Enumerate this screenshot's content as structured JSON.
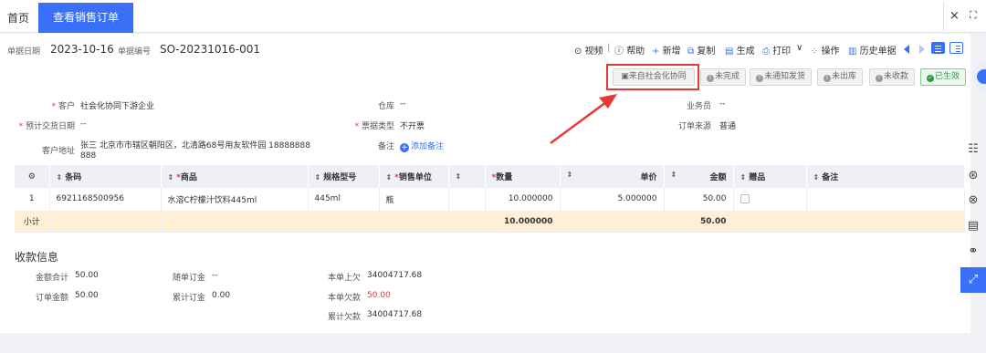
{
  "tabs": {
    "home": "首页",
    "active": "查看销售订单",
    "active_close": "×",
    "close_all": "×",
    "expand": "⛶"
  },
  "header": {
    "date_label": "单据日期",
    "date_value": "2023-10-16",
    "no_label": "单据编号",
    "no_value": "SO-20231016-001"
  },
  "toolbar": {
    "video": "视频",
    "sep": "|",
    "help": "帮助",
    "add": "新增",
    "copy": "复制",
    "generate": "生成",
    "print": "打印",
    "print_caret": "∨",
    "operate": "操作",
    "history": "历史单据"
  },
  "status": {
    "source": "来自社会化协同",
    "incomplete": "未完成",
    "not_notified": "未通知发货",
    "not_out": "未出库",
    "not_received": "未收款",
    "effective": "已生效",
    "effective_color": "#2e9b49",
    "highlight_color": "#e53935"
  },
  "form": {
    "customer_label": "客户",
    "customer_value": "社会化协同下游企业",
    "warehouse_label": "仓库",
    "warehouse_value": "--",
    "salesman_label": "业务员",
    "salesman_value": "--",
    "delivery_label": "预计交货日期",
    "delivery_value": "--",
    "invoice_label": "票据类型",
    "invoice_value": "不开票",
    "source_label": "订单来源",
    "source_value": "普通",
    "address_label": "客户地址",
    "address_line1": "张三 北京市市辖区朝阳区，北清路68号用友软件园 18888888",
    "address_line2": "888",
    "remark_label": "备注",
    "remark_add": "添加备注"
  },
  "table": {
    "columns": {
      "settings": "⚙",
      "code": "条码",
      "product": "商品",
      "spec": "规格型号",
      "unit": "销售单位",
      "blank": "",
      "qty": "数量",
      "price": "单价",
      "amount": "金额",
      "gift": "赠品",
      "note": "备注"
    },
    "rows": [
      {
        "no": "1",
        "code": "6921168500956",
        "product": "水溶C柠檬汁饮料445ml",
        "spec": "445ml",
        "unit": "瓶",
        "qty": "10.000000",
        "price": "5.000000",
        "amount": "50.00"
      }
    ],
    "subtotal": {
      "label": "小计",
      "qty": "10.000000",
      "amount": "50.00"
    }
  },
  "payment": {
    "title": "收款信息",
    "total_label": "金额合计",
    "total_value": "50.00",
    "order_amount_label": "订单金额",
    "order_amount_value": "50.00",
    "deposit_label": "随单订金",
    "deposit_value": "--",
    "acc_deposit_label": "累计订金",
    "acc_deposit_value": "0.00",
    "prev_owe_label": "本单上欠",
    "prev_owe_value": "34004717.68",
    "this_owe_label": "本单欠款",
    "this_owe_value": "50.00",
    "acc_owe_label": "累计欠款",
    "acc_owe_value": "34004717.68"
  },
  "rail": [
    "☷",
    "⊛",
    "⊗",
    "▤",
    "⚭",
    "⤢"
  ]
}
